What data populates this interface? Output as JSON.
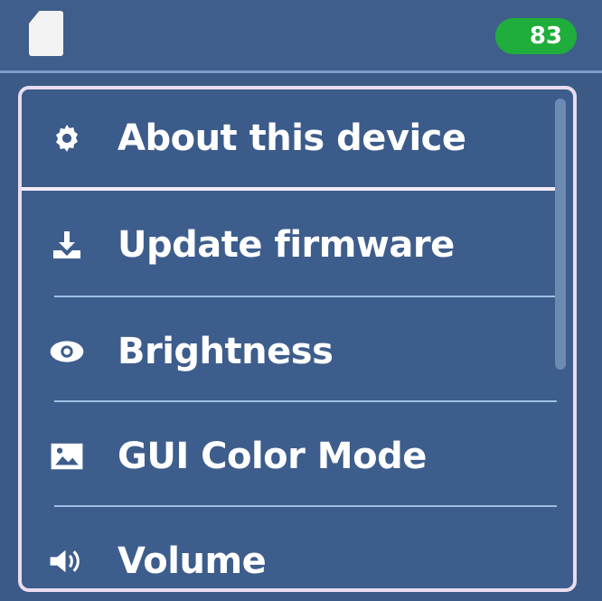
{
  "status_bar": {
    "sd_card_icon": "sd-card-icon",
    "battery_level": "83",
    "battery_color": "#1fae3b"
  },
  "menu": {
    "items": [
      {
        "label": "About this device",
        "icon": "gear-icon",
        "selected": true
      },
      {
        "label": "Update firmware",
        "icon": "download-icon",
        "selected": false
      },
      {
        "label": "Brightness",
        "icon": "eye-icon",
        "selected": false
      },
      {
        "label": "GUI Color Mode",
        "icon": "image-icon",
        "selected": false
      },
      {
        "label": "Volume",
        "icon": "speaker-icon",
        "selected": false
      }
    ]
  },
  "colors": {
    "background": "#3b5a86",
    "selection_border": "#f4eaf6",
    "divider": "#9fc0e6",
    "text": "#ffffff"
  }
}
